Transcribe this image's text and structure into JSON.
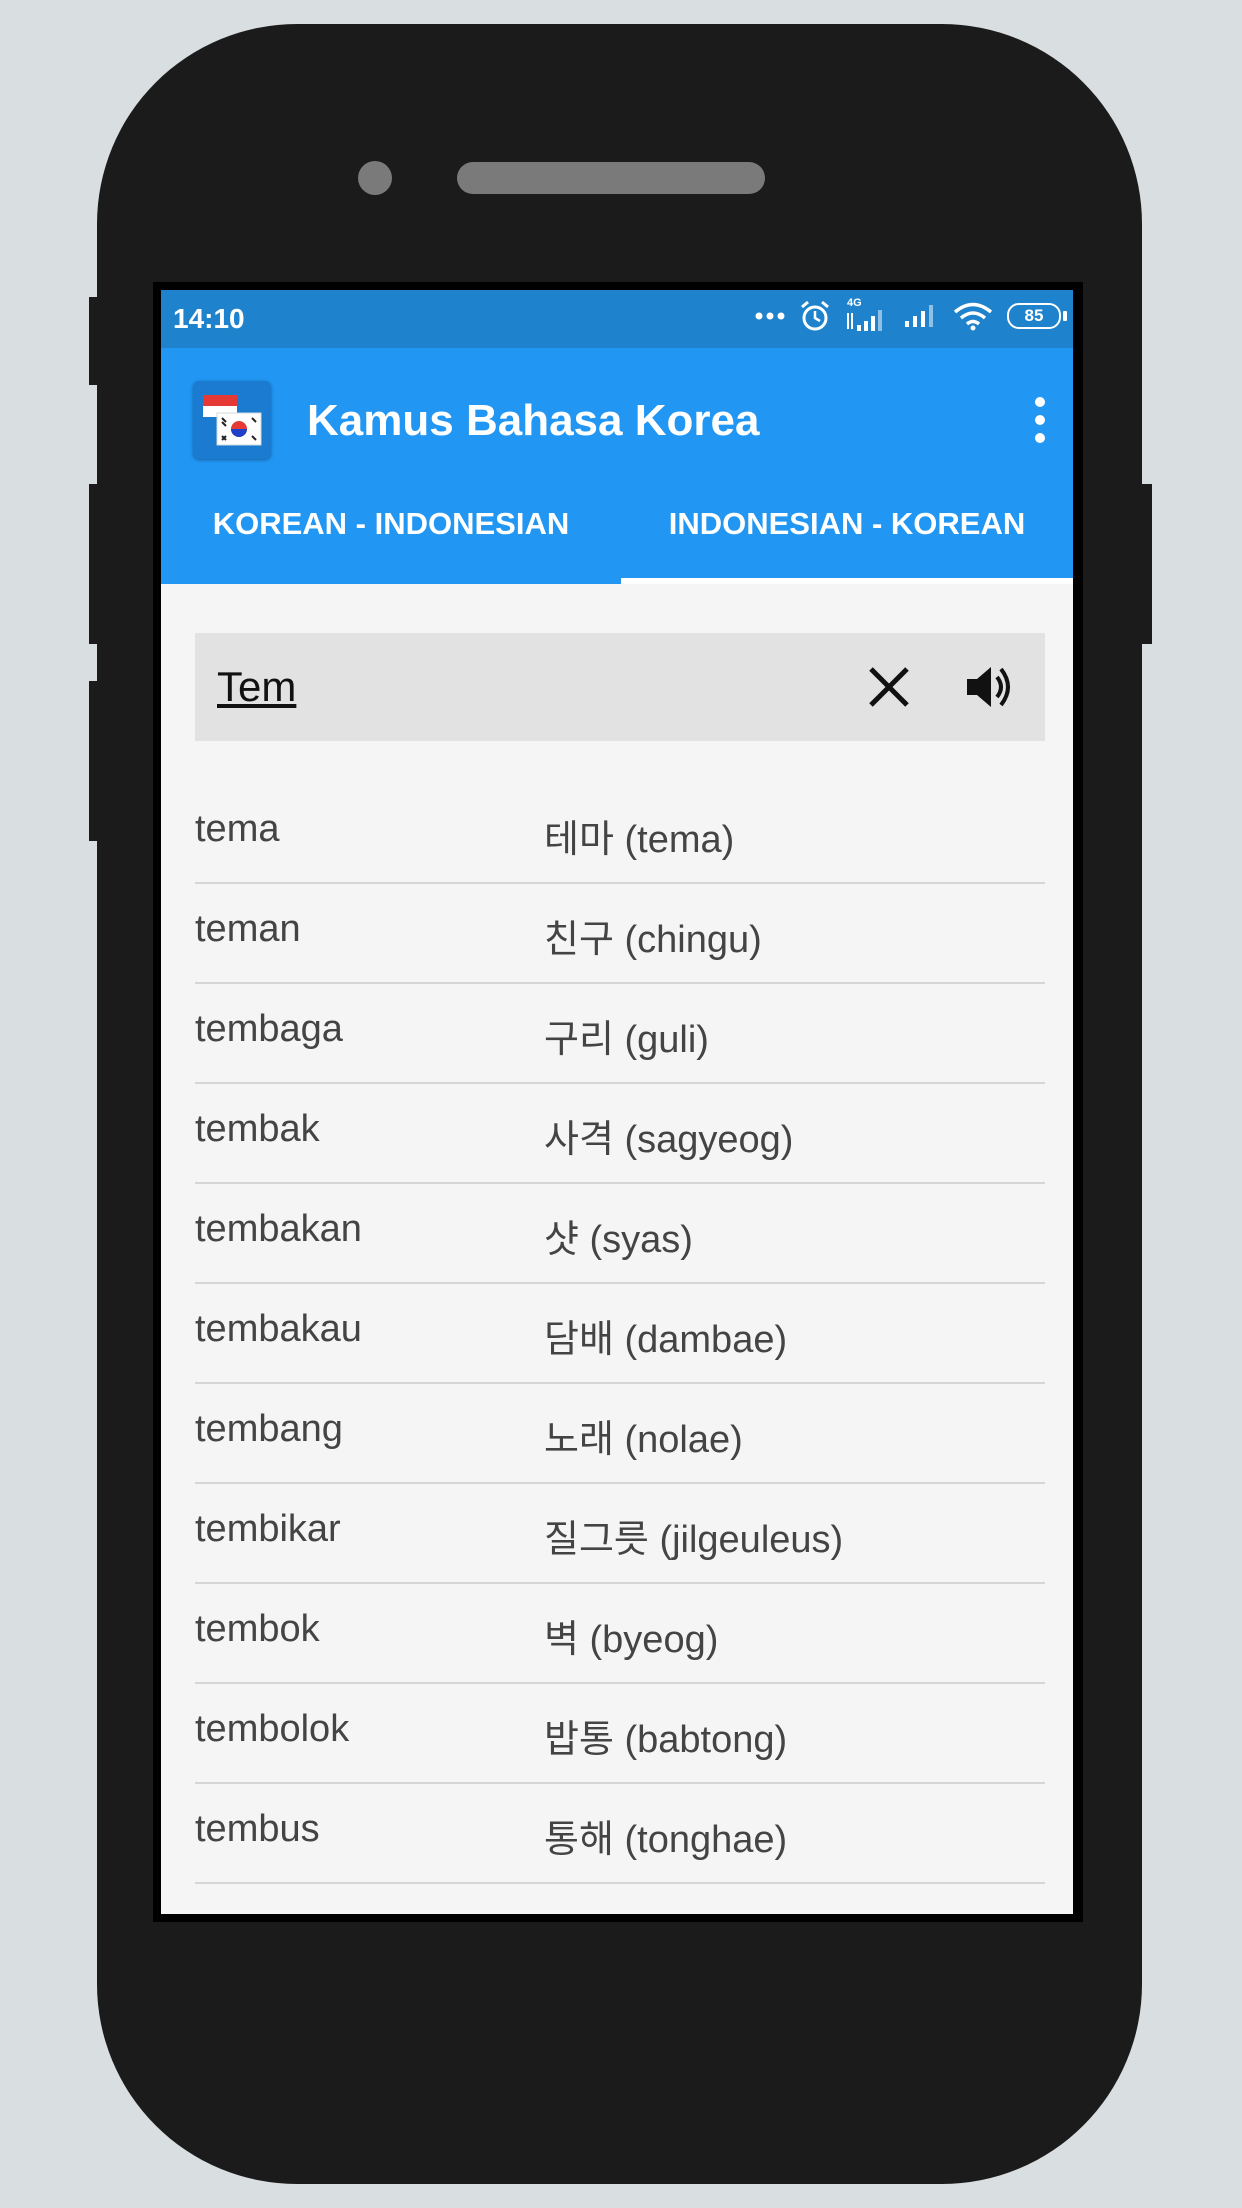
{
  "status_bar": {
    "time": "14:10",
    "network_label": "4G",
    "battery": "85",
    "icons": [
      "more-dots-icon",
      "alarm-icon",
      "signal-4g-icon",
      "signal-icon",
      "wifi-icon",
      "battery-icon"
    ]
  },
  "app_bar": {
    "title": "Kamus Bahasa Korea",
    "icon": "indonesia-korea-flag-icon",
    "menu_icon": "more-vert-icon"
  },
  "tabs": [
    {
      "label": "KOREAN - INDONESIAN",
      "selected": false
    },
    {
      "label": "INDONESIAN - KOREAN",
      "selected": true
    }
  ],
  "search": {
    "value": "Tem",
    "clear_icon": "close-icon",
    "speak_icon": "volume-icon"
  },
  "results": [
    {
      "word": "tema",
      "translation": "테마 (tema)"
    },
    {
      "word": "teman",
      "translation": "친구 (chingu)"
    },
    {
      "word": "tembaga",
      "translation": "구리 (guli)"
    },
    {
      "word": "tembak",
      "translation": "사격 (sagyeog)"
    },
    {
      "word": "tembakan",
      "translation": "샷 (syas)"
    },
    {
      "word": "tembakau",
      "translation": "담배 (dambae)"
    },
    {
      "word": "tembang",
      "translation": "노래 (nolae)"
    },
    {
      "word": "tembikar",
      "translation": "질그릇 (jilgeuleus)"
    },
    {
      "word": "tembok",
      "translation": "벽 (byeog)"
    },
    {
      "word": "tembolok",
      "translation": "밥통 (babtong)"
    },
    {
      "word": "tembus",
      "translation": "통해 (tonghae)"
    }
  ],
  "colors": {
    "status_bar": "#1e82cc",
    "app_bar": "#2196f3",
    "background": "#f5f5f5",
    "search_box": "#e2e2e2",
    "divider": "#d6d6d6",
    "phone_body": "#1b1b1b"
  }
}
